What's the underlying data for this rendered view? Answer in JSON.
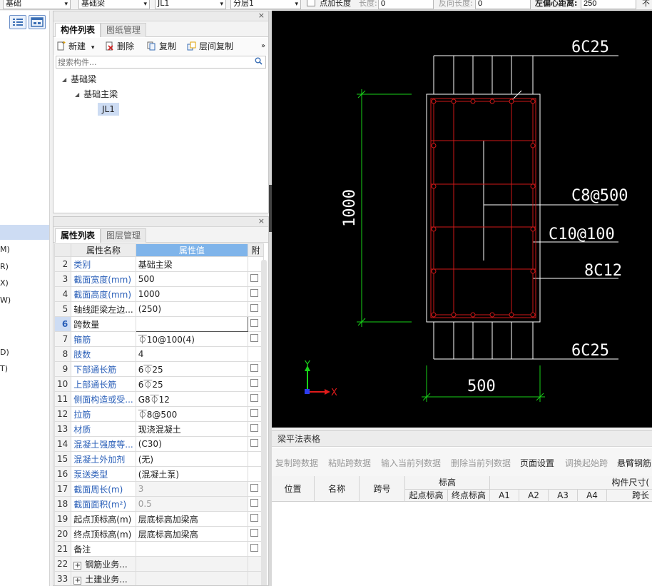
{
  "topbar": {
    "floor_select": "基础",
    "type_select": "基础梁",
    "name_select": "JL1",
    "layer_select": "分层1",
    "add_length_label": "点加长度",
    "length_label": "长度:",
    "length_value": "0",
    "reverse_length_label": "反向长度:",
    "reverse_length_value": "0",
    "left_offset_label": "左偏心距离:",
    "left_offset_value": "250",
    "cut_label": "不"
  },
  "leftnav": {
    "items": [
      "M)",
      "R)",
      "X)",
      "W)",
      "D)",
      "T)"
    ]
  },
  "component_panel": {
    "tabs": [
      "构件列表",
      "图纸管理"
    ],
    "toolbar": {
      "new": "新建",
      "delete": "删除",
      "copy": "复制",
      "floor_copy": "层间复制",
      "more": "»"
    },
    "search_placeholder": "搜索构件...",
    "tree": {
      "root": "基础梁",
      "child": "基础主梁",
      "leaf": "JL1"
    }
  },
  "property_panel": {
    "tabs": [
      "属性列表",
      "图层管理"
    ],
    "headers": {
      "name": "属性名称",
      "value": "属性值",
      "attach": "附"
    },
    "rows": [
      {
        "n": "2",
        "name": "类别",
        "value": "基础主梁",
        "blue": true,
        "chk": false
      },
      {
        "n": "3",
        "name": "截面宽度(mm)",
        "value": "500",
        "blue": true,
        "chk": true
      },
      {
        "n": "4",
        "name": "截面高度(mm)",
        "value": "1000",
        "blue": true,
        "chk": true
      },
      {
        "n": "5",
        "name": "轴线距梁左边...",
        "value": "(250)",
        "blue": false,
        "chk": true
      },
      {
        "n": "6",
        "name": "跨数量",
        "value": "",
        "blue": false,
        "chk": true,
        "sel": true
      },
      {
        "n": "7",
        "name": "箍筋",
        "value": "⏁10@100(4)",
        "blue": true,
        "chk": true
      },
      {
        "n": "8",
        "name": "肢数",
        "value": "4",
        "blue": true,
        "chk": false
      },
      {
        "n": "9",
        "name": "下部通长筋",
        "value": "6⏁25",
        "blue": true,
        "chk": true
      },
      {
        "n": "10",
        "name": "上部通长筋",
        "value": "6⏁25",
        "blue": true,
        "chk": true
      },
      {
        "n": "11",
        "name": "侧面构造或受...",
        "value": "G8⏁12",
        "blue": true,
        "chk": true
      },
      {
        "n": "12",
        "name": "拉筋",
        "value": "⏁8@500",
        "blue": true,
        "chk": true
      },
      {
        "n": "13",
        "name": "材质",
        "value": "现浇混凝土",
        "blue": true,
        "chk": true
      },
      {
        "n": "14",
        "name": "混凝土强度等...",
        "value": "(C30)",
        "blue": true,
        "chk": true
      },
      {
        "n": "15",
        "name": "混凝土外加剂",
        "value": "(无)",
        "blue": true,
        "chk": false
      },
      {
        "n": "16",
        "name": "泵送类型",
        "value": "(混凝土泵)",
        "blue": true,
        "chk": false
      },
      {
        "n": "17",
        "name": "截面周长(m)",
        "value": "3",
        "blue": true,
        "chk": true,
        "gray": true
      },
      {
        "n": "18",
        "name": "截面面积(m²)",
        "value": "0.5",
        "blue": true,
        "chk": true,
        "gray": true
      },
      {
        "n": "19",
        "name": "起点顶标高(m)",
        "value": "层底标高加梁高",
        "blue": false,
        "chk": true
      },
      {
        "n": "20",
        "name": "终点顶标高(m)",
        "value": "层底标高加梁高",
        "blue": false,
        "chk": true
      },
      {
        "n": "21",
        "name": "备注",
        "value": "",
        "blue": false,
        "chk": true
      },
      {
        "n": "22",
        "name": "钢筋业务...",
        "value": "",
        "blue": false,
        "chk": false,
        "grp": true
      },
      {
        "n": "33",
        "name": "土建业务...",
        "value": "",
        "blue": false,
        "chk": false,
        "grp": true
      }
    ]
  },
  "cad": {
    "top_rebar": "6C25",
    "height_dim": "1000",
    "tie_label": "C8@500",
    "stirrup_label": "C10@100",
    "side_rebar": "8C12",
    "bottom_rebar": "6C25",
    "width_dim": "500",
    "axis_y": "Y",
    "axis_x": "X",
    "colors": {
      "background": "#000000",
      "outline": "#ffffff",
      "rebar": "#d01818",
      "dimension": "#19d219"
    }
  },
  "beam_table": {
    "title": "梁平法表格",
    "toolbar": [
      "复制跨数据",
      "粘贴跨数据",
      "输入当前列数据",
      "删除当前列数据",
      "页面设置",
      "调换起始跨",
      "悬臂钢筋"
    ],
    "columns": {
      "position": "位置",
      "name": "名称",
      "span": "跨号",
      "elevation": "标高",
      "start_elev": "起点标高",
      "end_elev": "终点标高",
      "size": "构件尺寸(",
      "a1": "A1",
      "a2": "A2",
      "a3": "A3",
      "a4": "A4",
      "span_len": "跨长"
    }
  }
}
